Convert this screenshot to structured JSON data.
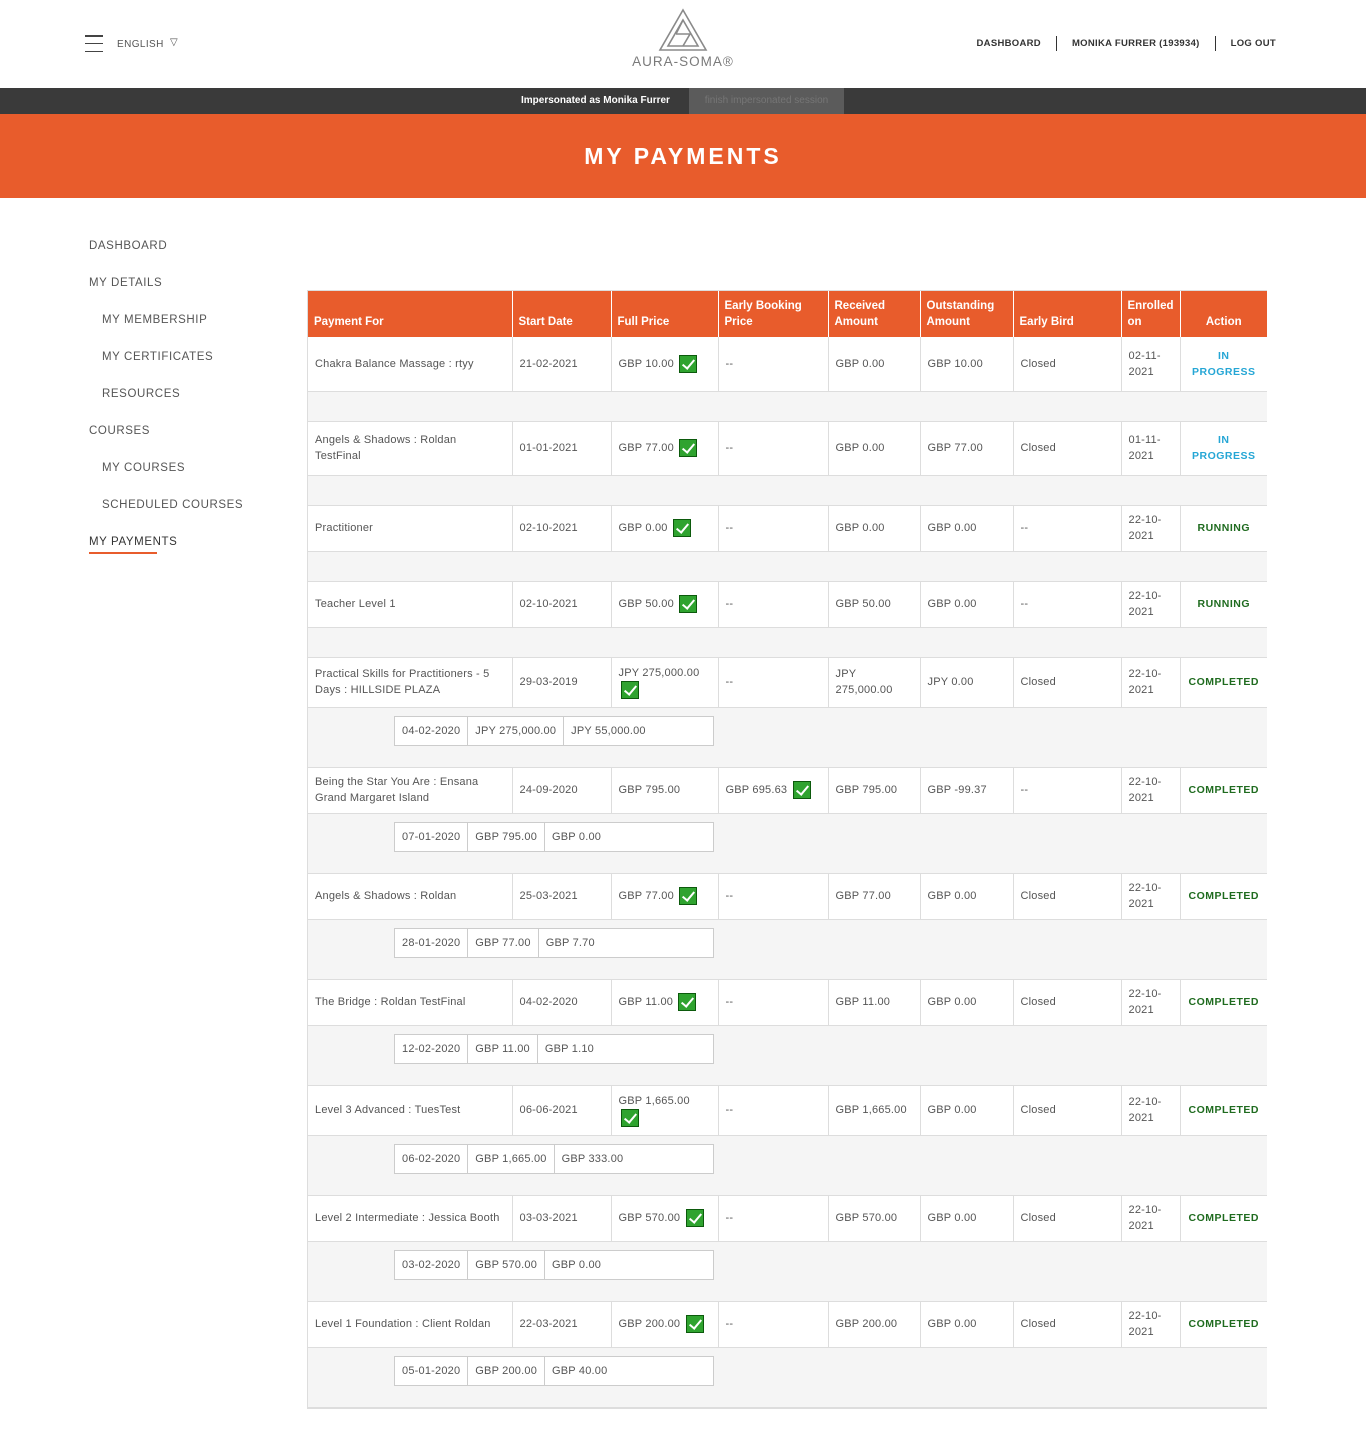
{
  "header": {
    "language": "ENGLISH",
    "logo_text": "AURA-SOMA®",
    "nav": [
      "DASHBOARD",
      "MONIKA FURRER (193934)",
      "LOG OUT"
    ]
  },
  "impersonation": {
    "text": "Impersonated as Monika Furrer",
    "button": "finish impersonated session"
  },
  "page_title": "MY PAYMENTS",
  "sidebar": [
    {
      "label": "DASHBOARD",
      "sub": false
    },
    {
      "label": "MY DETAILS",
      "sub": false
    },
    {
      "label": "MY MEMBERSHIP",
      "sub": true
    },
    {
      "label": "MY CERTIFICATES",
      "sub": true
    },
    {
      "label": "RESOURCES",
      "sub": true
    },
    {
      "label": "COURSES",
      "sub": false
    },
    {
      "label": "MY COURSES",
      "sub": true
    },
    {
      "label": "SCHEDULED COURSES",
      "sub": true
    },
    {
      "label": "MY PAYMENTS",
      "sub": false,
      "active": true
    }
  ],
  "table": {
    "headers": [
      "Payment For",
      "Start Date",
      "Full Price",
      "Early Booking Price",
      "Received Amount",
      "Outstanding Amount",
      "Early Bird",
      "Enrolled on",
      "Action"
    ],
    "rows": [
      {
        "payment_for": "Chakra Balance Massage : rtyy",
        "start": "21-02-2021",
        "full": "GBP 10.00",
        "full_check": true,
        "early": "--",
        "early_check": false,
        "received": "GBP 0.00",
        "outstanding": "GBP 10.00",
        "bird": "Closed",
        "enrolled": "02-11-2021",
        "action": "IN PROGRESS",
        "status": "progress",
        "subs": []
      },
      {
        "payment_for": "Angels & Shadows : Roldan TestFinal",
        "start": "01-01-2021",
        "full": "GBP 77.00",
        "full_check": true,
        "early": "--",
        "early_check": false,
        "received": "GBP 0.00",
        "outstanding": "GBP 77.00",
        "bird": "Closed",
        "enrolled": "01-11-2021",
        "action": "IN PROGRESS",
        "status": "progress",
        "subs": []
      },
      {
        "payment_for": "Practitioner",
        "start": "02-10-2021",
        "full": "GBP 0.00",
        "full_check": true,
        "early": "--",
        "early_check": false,
        "received": "GBP 0.00",
        "outstanding": "GBP 0.00",
        "bird": "--",
        "enrolled": "22-10-2021",
        "action": "RUNNING",
        "status": "running",
        "subs": []
      },
      {
        "payment_for": "Teacher Level 1",
        "start": "02-10-2021",
        "full": "GBP 50.00",
        "full_check": true,
        "early": "--",
        "early_check": false,
        "received": "GBP 50.00",
        "outstanding": "GBP 0.00",
        "bird": "--",
        "enrolled": "22-10-2021",
        "action": "RUNNING",
        "status": "running",
        "subs": []
      },
      {
        "payment_for": "Practical Skills for Practitioners - 5 Days : HILLSIDE PLAZA",
        "start": "29-03-2019",
        "full": "JPY 275,000.00",
        "full_check": true,
        "early": "--",
        "early_check": false,
        "received": "JPY 275,000.00",
        "outstanding": "JPY 0.00",
        "bird": "Closed",
        "enrolled": "22-10-2021",
        "action": "COMPLETED",
        "status": "completed",
        "subs": [
          [
            "04-02-2020",
            "JPY 275,000.00",
            "JPY 55,000.00"
          ]
        ]
      },
      {
        "payment_for": "Being the Star You Are : Ensana Grand Margaret Island",
        "start": "24-09-2020",
        "full": "GBP 795.00",
        "full_check": false,
        "early": "GBP 695.63",
        "early_check": true,
        "received": "GBP 795.00",
        "outstanding": "GBP -99.37",
        "bird": "--",
        "enrolled": "22-10-2021",
        "action": "COMPLETED",
        "status": "completed",
        "subs": [
          [
            "07-01-2020",
            "GBP 795.00",
            "GBP 0.00"
          ]
        ]
      },
      {
        "payment_for": "Angels & Shadows : Roldan",
        "start": "25-03-2021",
        "full": "GBP 77.00",
        "full_check": true,
        "early": "--",
        "early_check": false,
        "received": "GBP 77.00",
        "outstanding": "GBP 0.00",
        "bird": "Closed",
        "enrolled": "22-10-2021",
        "action": "COMPLETED",
        "status": "completed",
        "subs": [
          [
            "28-01-2020",
            "GBP 77.00",
            "GBP 7.70"
          ]
        ]
      },
      {
        "payment_for": "The Bridge : Roldan TestFinal",
        "start": "04-02-2020",
        "full": "GBP 11.00",
        "full_check": true,
        "early": "--",
        "early_check": false,
        "received": "GBP 11.00",
        "outstanding": "GBP 0.00",
        "bird": "Closed",
        "enrolled": "22-10-2021",
        "action": "COMPLETED",
        "status": "completed",
        "subs": [
          [
            "12-02-2020",
            "GBP 11.00",
            "GBP 1.10"
          ]
        ]
      },
      {
        "payment_for": "Level 3 Advanced : TuesTest",
        "start": "06-06-2021",
        "full": "GBP 1,665.00",
        "full_check": true,
        "early": "--",
        "early_check": false,
        "received": "GBP 1,665.00",
        "outstanding": "GBP 0.00",
        "bird": "Closed",
        "enrolled": "22-10-2021",
        "action": "COMPLETED",
        "status": "completed",
        "subs": [
          [
            "06-02-2020",
            "GBP 1,665.00",
            "GBP 333.00"
          ]
        ]
      },
      {
        "payment_for": "Level 2 Intermediate : Jessica Booth",
        "start": "03-03-2021",
        "full": "GBP 570.00",
        "full_check": true,
        "early": "--",
        "early_check": false,
        "received": "GBP 570.00",
        "outstanding": "GBP 0.00",
        "bird": "Closed",
        "enrolled": "22-10-2021",
        "action": "COMPLETED",
        "status": "completed",
        "subs": [
          [
            "03-02-2020",
            "GBP 570.00",
            "GBP 0.00"
          ]
        ]
      },
      {
        "payment_for": "Level 1 Foundation : Client Roldan",
        "start": "22-03-2021",
        "full": "GBP 200.00",
        "full_check": true,
        "early": "--",
        "early_check": false,
        "received": "GBP 200.00",
        "outstanding": "GBP 0.00",
        "bird": "Closed",
        "enrolled": "22-10-2021",
        "action": "COMPLETED",
        "status": "completed",
        "subs": [
          [
            "05-01-2020",
            "GBP 200.00",
            "GBP 40.00"
          ]
        ]
      }
    ]
  },
  "colors": {
    "accent": "#e85c2c",
    "in_progress": "#25a6d5",
    "running": "#1f6b1f",
    "completed": "#1f6b1f",
    "check": "#2fa32f"
  }
}
